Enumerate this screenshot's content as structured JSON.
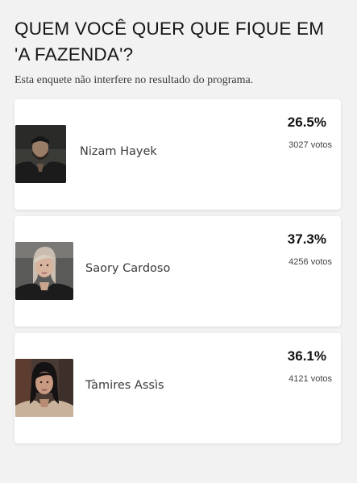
{
  "poll": {
    "title": "QUEM VOCÊ QUER QUE FIQUE EM 'A FAZENDA'?",
    "subtitle": "Esta enquete não interfere no resultado do programa.",
    "options": [
      {
        "name": "Nizam Hayek",
        "percent": "26.5%",
        "votes": "3027 votos",
        "photo_icon": "nizam-hayek-photo"
      },
      {
        "name": "Saory Cardoso",
        "percent": "37.3%",
        "votes": "4256 votos",
        "photo_icon": "saory-cardoso-photo"
      },
      {
        "name": "Tàmires Assìs",
        "percent": "36.1%",
        "votes": "4121 votos",
        "photo_icon": "tamires-assis-photo"
      }
    ]
  },
  "colors": {
    "background": "#f2f2f3",
    "card": "#ffffff",
    "text": "#141414"
  }
}
